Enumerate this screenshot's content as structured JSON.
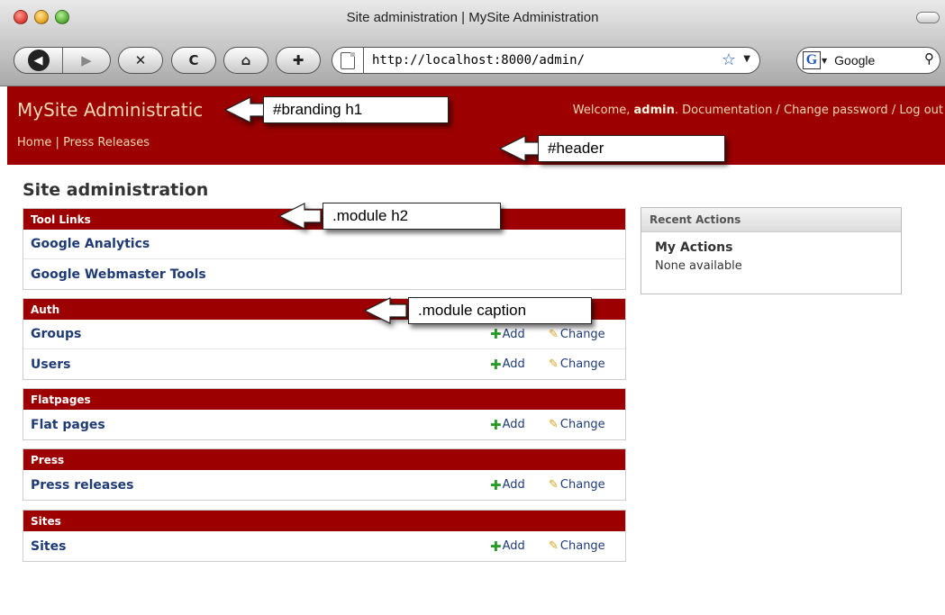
{
  "browser": {
    "window_title": "Site administration | MySite Administration",
    "url": "http://localhost:8000/admin/",
    "search_engine": "Google",
    "buttons": {
      "back": "◀",
      "forward": "▶",
      "stop": "✕",
      "reload": "C",
      "home": "⌂",
      "bookmark": "✚"
    }
  },
  "admin": {
    "branding": "MySite Administratic",
    "user_tools": {
      "welcome": "Welcome,",
      "user": "admin",
      "period": ".",
      "documentation": "Documentation",
      "sep1": "/",
      "change_password": "Change password",
      "sep2": "/",
      "logout": "Log out"
    },
    "breadcrumbs": {
      "home": "Home",
      "sep": "|",
      "press": "Press Releases"
    }
  },
  "content": {
    "page_title": "Site administration",
    "modules": [
      {
        "caption": "Tool Links",
        "rows": [
          {
            "label": "Google Analytics"
          },
          {
            "label": "Google Webmaster Tools"
          }
        ]
      },
      {
        "caption": "Auth",
        "rows": [
          {
            "label": "Groups",
            "add": "Add",
            "change": "Change"
          },
          {
            "label": "Users",
            "add": "Add",
            "change": "Change"
          }
        ]
      },
      {
        "caption": "Flatpages",
        "rows": [
          {
            "label": "Flat pages",
            "add": "Add",
            "change": "Change"
          }
        ]
      },
      {
        "caption": "Press",
        "rows": [
          {
            "label": "Press releases",
            "add": "Add",
            "change": "Change"
          }
        ]
      },
      {
        "caption": "Sites",
        "rows": [
          {
            "label": "Sites",
            "add": "Add",
            "change": "Change"
          }
        ]
      }
    ],
    "recent_actions": {
      "title": "Recent Actions",
      "subtitle": "My Actions",
      "empty": "None available"
    }
  },
  "annotations": {
    "branding": "#branding h1",
    "header": "#header",
    "module_h2": ".module h2",
    "module_caption": ".module caption"
  },
  "colors": {
    "header_bg": "#9c0000",
    "header_text": "#f4d9b6",
    "link": "#1f3b76",
    "add_icon": "#2a9a2a",
    "change_icon": "#d6a21e"
  }
}
